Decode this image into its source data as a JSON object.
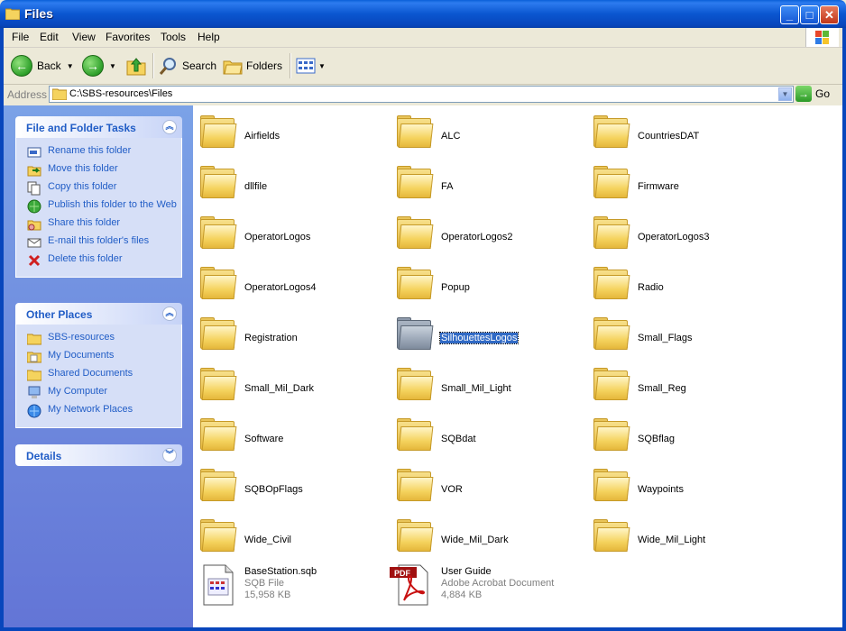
{
  "window": {
    "title": "Files"
  },
  "menu": [
    "File",
    "Edit",
    "View",
    "Favorites",
    "Tools",
    "Help"
  ],
  "toolbar": {
    "back": "Back",
    "search": "Search",
    "folders": "Folders"
  },
  "address": {
    "label": "Address",
    "path": "C:\\SBS-resources\\Files",
    "go": "Go"
  },
  "tasks": {
    "title": "File and Folder Tasks",
    "items": [
      {
        "label": "Rename this folder",
        "icon": "rename-icon"
      },
      {
        "label": "Move this folder",
        "icon": "move-icon"
      },
      {
        "label": "Copy this folder",
        "icon": "copy-icon"
      },
      {
        "label": "Publish this folder to the Web",
        "icon": "publish-web-icon"
      },
      {
        "label": "Share this folder",
        "icon": "share-icon"
      },
      {
        "label": "E-mail this folder's files",
        "icon": "email-icon"
      },
      {
        "label": "Delete this folder",
        "icon": "delete-icon"
      }
    ]
  },
  "places": {
    "title": "Other Places",
    "items": [
      {
        "label": "SBS-resources",
        "icon": "folder-icon"
      },
      {
        "label": "My Documents",
        "icon": "my-documents-icon"
      },
      {
        "label": "Shared Documents",
        "icon": "shared-documents-icon"
      },
      {
        "label": "My Computer",
        "icon": "my-computer-icon"
      },
      {
        "label": "My Network Places",
        "icon": "network-places-icon"
      }
    ]
  },
  "details": {
    "title": "Details"
  },
  "folders": [
    {
      "name": "Airfields"
    },
    {
      "name": "ALC"
    },
    {
      "name": "CountriesDAT"
    },
    {
      "name": "dllfile"
    },
    {
      "name": "FA"
    },
    {
      "name": "Firmware"
    },
    {
      "name": "OperatorLogos"
    },
    {
      "name": "OperatorLogos2"
    },
    {
      "name": "OperatorLogos3"
    },
    {
      "name": "OperatorLogos4"
    },
    {
      "name": "Popup"
    },
    {
      "name": "Radio"
    },
    {
      "name": "Registration"
    },
    {
      "name": "SilhouettesLogos",
      "selected": true
    },
    {
      "name": "Small_Flags"
    },
    {
      "name": "Small_Mil_Dark"
    },
    {
      "name": "Small_Mil_Light"
    },
    {
      "name": "Small_Reg"
    },
    {
      "name": "Software"
    },
    {
      "name": "SQBdat"
    },
    {
      "name": "SQBflag"
    },
    {
      "name": "SQBOpFlags"
    },
    {
      "name": "VOR"
    },
    {
      "name": "Waypoints"
    },
    {
      "name": "Wide_Civil"
    },
    {
      "name": "Wide_Mil_Dark"
    },
    {
      "name": "Wide_Mil_Light"
    }
  ],
  "files": [
    {
      "name": "BaseStation.sqb",
      "type": "SQB File",
      "size": "15,958 KB",
      "icon": "sqb-file-icon"
    },
    {
      "name": "User Guide",
      "type": "Adobe Acrobat Document",
      "size": "4,884 KB",
      "icon": "pdf-file-icon"
    }
  ]
}
